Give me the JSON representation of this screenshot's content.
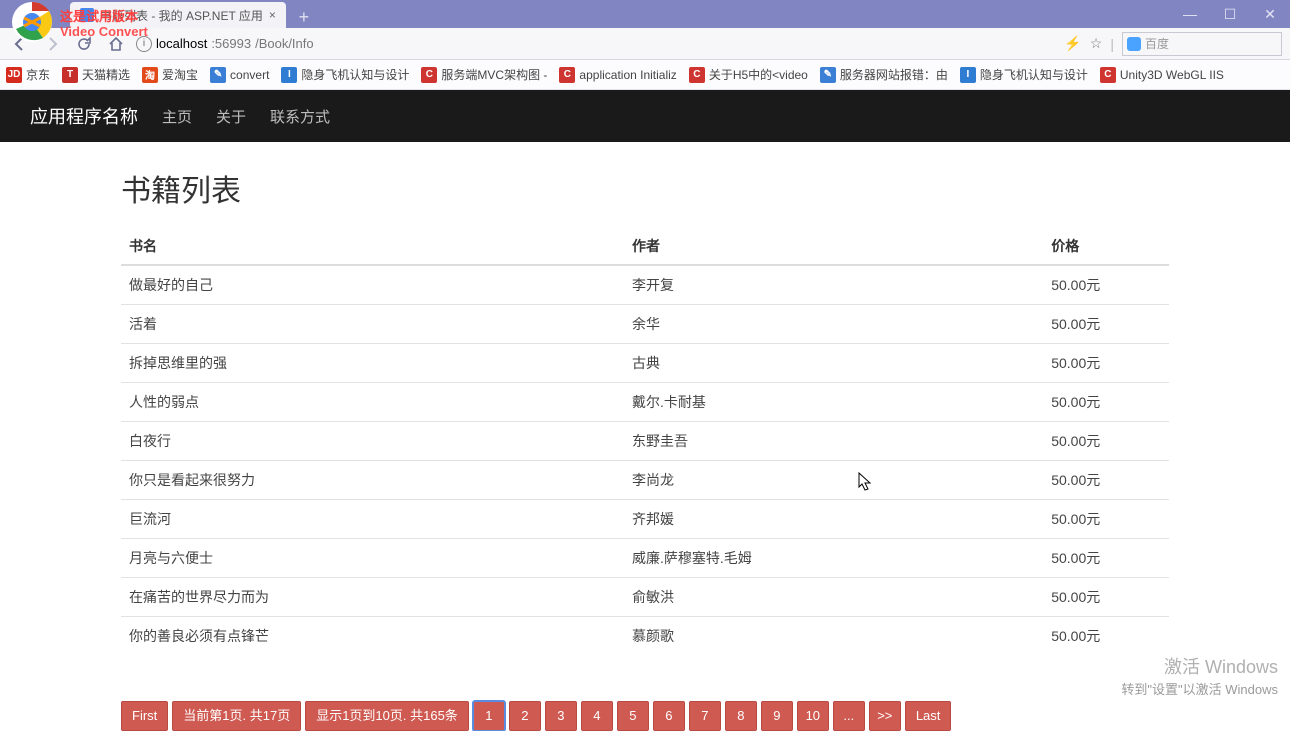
{
  "browser": {
    "overlay_line1": "这是试用版本",
    "overlay_line2": "Video Convert",
    "tab_title": "书籍列表 - 我的 ASP.NET 应用",
    "url_host": "localhost",
    "url_port": ":56993",
    "url_path": "/Book/Info",
    "search_placeholder": "百度",
    "window_buttons": {
      "min": "—",
      "max": "☐",
      "close": "✕"
    }
  },
  "bookmarks": [
    {
      "icon": "ic-jd",
      "label": "京东"
    },
    {
      "icon": "ic-t",
      "label": "天猫精选"
    },
    {
      "icon": "ic-tao",
      "label": "爱淘宝"
    },
    {
      "icon": "ic-doc",
      "label": "convert"
    },
    {
      "icon": "ic-i",
      "label": "隐身飞机认知与设计"
    },
    {
      "icon": "ic-c",
      "label": "服务端MVC架构图 -"
    },
    {
      "icon": "ic-c",
      "label": "application Initializ"
    },
    {
      "icon": "ic-c",
      "label": "关于H5中的<video"
    },
    {
      "icon": "ic-doc",
      "label": "服务器网站报错：由"
    },
    {
      "icon": "ic-i",
      "label": "隐身飞机认知与设计"
    },
    {
      "icon": "ic-c",
      "label": "Unity3D WebGL IIS"
    }
  ],
  "nav": {
    "brand": "应用程序名称",
    "links": [
      "主页",
      "关于",
      "联系方式"
    ]
  },
  "page": {
    "title": "书籍列表",
    "columns": {
      "name": "书名",
      "author": "作者",
      "price": "价格"
    },
    "rows": [
      {
        "name": "做最好的自己",
        "author": "李开复",
        "price": "50.00元"
      },
      {
        "name": "活着",
        "author": "余华",
        "price": "50.00元"
      },
      {
        "name": "拆掉思维里的强",
        "author": "古典",
        "price": "50.00元"
      },
      {
        "name": "人性的弱点",
        "author": "戴尔.卡耐基",
        "price": "50.00元"
      },
      {
        "name": "白夜行",
        "author": "东野圭吾",
        "price": "50.00元"
      },
      {
        "name": "你只是看起来很努力",
        "author": "李尚龙",
        "price": "50.00元"
      },
      {
        "name": "巨流河",
        "author": "齐邦媛",
        "price": "50.00元"
      },
      {
        "name": "月亮与六便士",
        "author": "威廉.萨穆塞特.毛姆",
        "price": "50.00元"
      },
      {
        "name": "在痛苦的世界尽力而为",
        "author": "俞敏洪",
        "price": "50.00元"
      },
      {
        "name": "你的善良必须有点锋芒",
        "author": "慕颜歌",
        "price": "50.00元"
      }
    ]
  },
  "pager": {
    "first": "First",
    "current_info": "当前第1页. 共17页",
    "range_info": "显示1页到10页. 共165条",
    "pages": [
      "1",
      "2",
      "3",
      "4",
      "5",
      "6",
      "7",
      "8",
      "9",
      "10"
    ],
    "ellipsis": "...",
    "next": ">>",
    "last": "Last",
    "active_index": 0
  },
  "watermark": {
    "line1": "激活 Windows",
    "line2": "转到\"设置\"以激活 Windows"
  }
}
